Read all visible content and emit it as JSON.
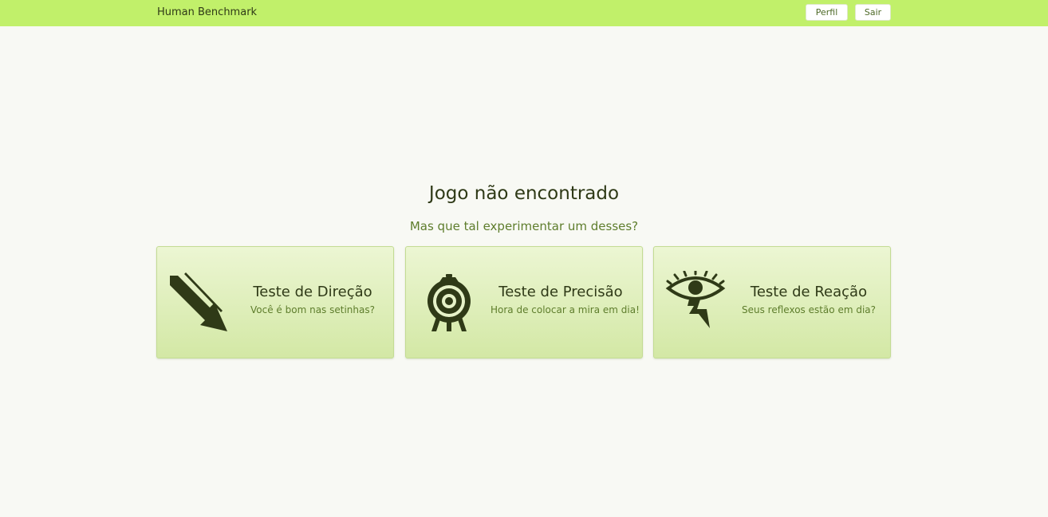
{
  "navbar": {
    "brand": "Human Benchmark",
    "profile_label": "Perfil",
    "logout_label": "Sair",
    "background": "#c1f06a"
  },
  "main": {
    "title": "Jogo não encontrado",
    "subtitle": "Mas que tal experimentar um desses?"
  },
  "cards": [
    {
      "icon": "arrow-down-right-icon",
      "title": "Teste de Direção",
      "description": "Você é bom nas setinhas?"
    },
    {
      "icon": "archery-target-icon",
      "title": "Teste de Precisão",
      "description": "Hora de colocar a mira em dia!"
    },
    {
      "icon": "eye-lightning-icon",
      "title": "Teste de Reação",
      "description": "Seus reflexos estão em dia?"
    }
  ],
  "colors": {
    "icon": "#2f3a17",
    "accent_text": "#5e7d2c",
    "page_background": "#f8f9f4"
  }
}
